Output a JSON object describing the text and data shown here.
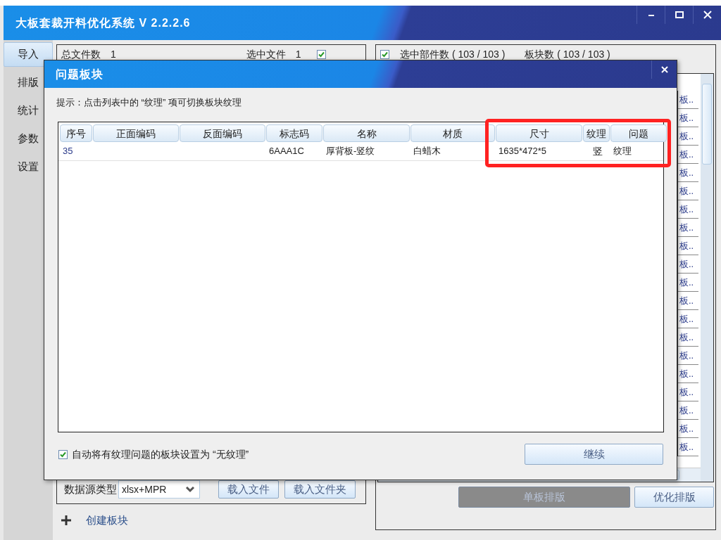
{
  "window": {
    "title": "大板套裁开料优化系统 V 2.2.2.6"
  },
  "sidebar": {
    "items": [
      {
        "label": "导入",
        "selected": true
      },
      {
        "label": "排版",
        "selected": false
      },
      {
        "label": "统计",
        "selected": false
      },
      {
        "label": "参数",
        "selected": false
      },
      {
        "label": "设置",
        "selected": false
      }
    ]
  },
  "left_panel": {
    "total_files_label": "总文件数",
    "total_files": "1",
    "selected_files_label": "选中文件",
    "selected_files": "1",
    "select_all_checked": true,
    "source_type_label": "数据源类型",
    "source_type": "xlsx+MPR",
    "buttons": [
      "载入文件",
      "载入文件夹"
    ],
    "create_link": "创建板块"
  },
  "right_panel": {
    "select_all_checked": true,
    "selected_parts": "选中部件数 ( 103 / 103 )",
    "boards": "板块数 ( 103 / 103 )",
    "list_cells": [
      "板..",
      "板..",
      "板..",
      "板..",
      "板..",
      "板..",
      "板..",
      "板..",
      "板..",
      "板..",
      "板..",
      "板..",
      "板..",
      "板..",
      "板..",
      "板..",
      "板..",
      "板..",
      "板..",
      "板.."
    ],
    "buttons": [
      {
        "label": "单板排版",
        "disabled": true
      },
      {
        "label": "优化排版",
        "disabled": false
      }
    ]
  },
  "dialog": {
    "title": "问题板块",
    "hint": "提示：点击列表中的 “纹理” 项可切换板块纹理",
    "table": {
      "columns": [
        "序号",
        "正面编码",
        "反面编码",
        "标志码",
        "名称",
        "材质",
        "尺寸",
        "纹理",
        "问题"
      ],
      "rows": [
        {
          "cells": [
            "35",
            null,
            null,
            "6AAA1C",
            "厚背板-竖纹",
            "白蜡木",
            "1635*472*5",
            "竖",
            "纹理"
          ]
        }
      ]
    },
    "auto_option": {
      "label": "自动将有纹理问题的板块设置为 “无纹理”",
      "checked": true
    },
    "continue_button": "继续"
  }
}
